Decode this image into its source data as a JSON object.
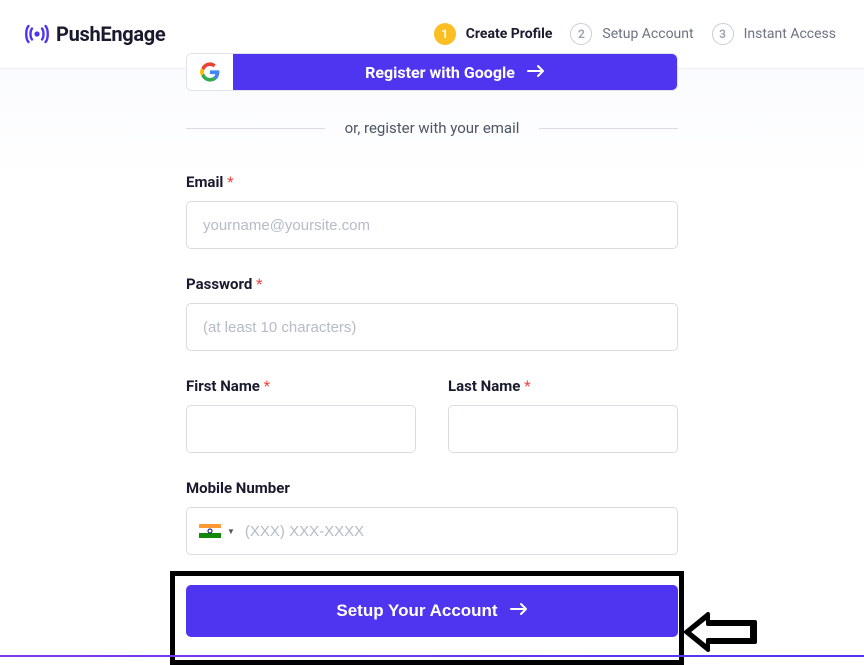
{
  "brand": {
    "name": "PushEngage",
    "accent_color": "#4f35f0"
  },
  "steps": [
    {
      "num": "1",
      "label": "Create Profile",
      "active": true
    },
    {
      "num": "2",
      "label": "Setup Account",
      "active": false
    },
    {
      "num": "3",
      "label": "Instant Access",
      "active": false
    }
  ],
  "google_button": "Register with Google",
  "divider_text": "or, register with your email",
  "fields": {
    "email": {
      "label": "Email",
      "placeholder": "yourname@yoursite.com",
      "required": true,
      "value": ""
    },
    "password": {
      "label": "Password",
      "placeholder": "(at least 10 characters)",
      "required": true,
      "value": ""
    },
    "first_name": {
      "label": "First Name",
      "placeholder": "",
      "required": true,
      "value": ""
    },
    "last_name": {
      "label": "Last Name",
      "placeholder": "",
      "required": true,
      "value": ""
    },
    "mobile": {
      "label": "Mobile Number",
      "placeholder": "(XXX) XXX-XXXX",
      "required": false,
      "value": "",
      "country": "IN"
    }
  },
  "required_mark": "*",
  "submit_label": "Setup Your Account"
}
